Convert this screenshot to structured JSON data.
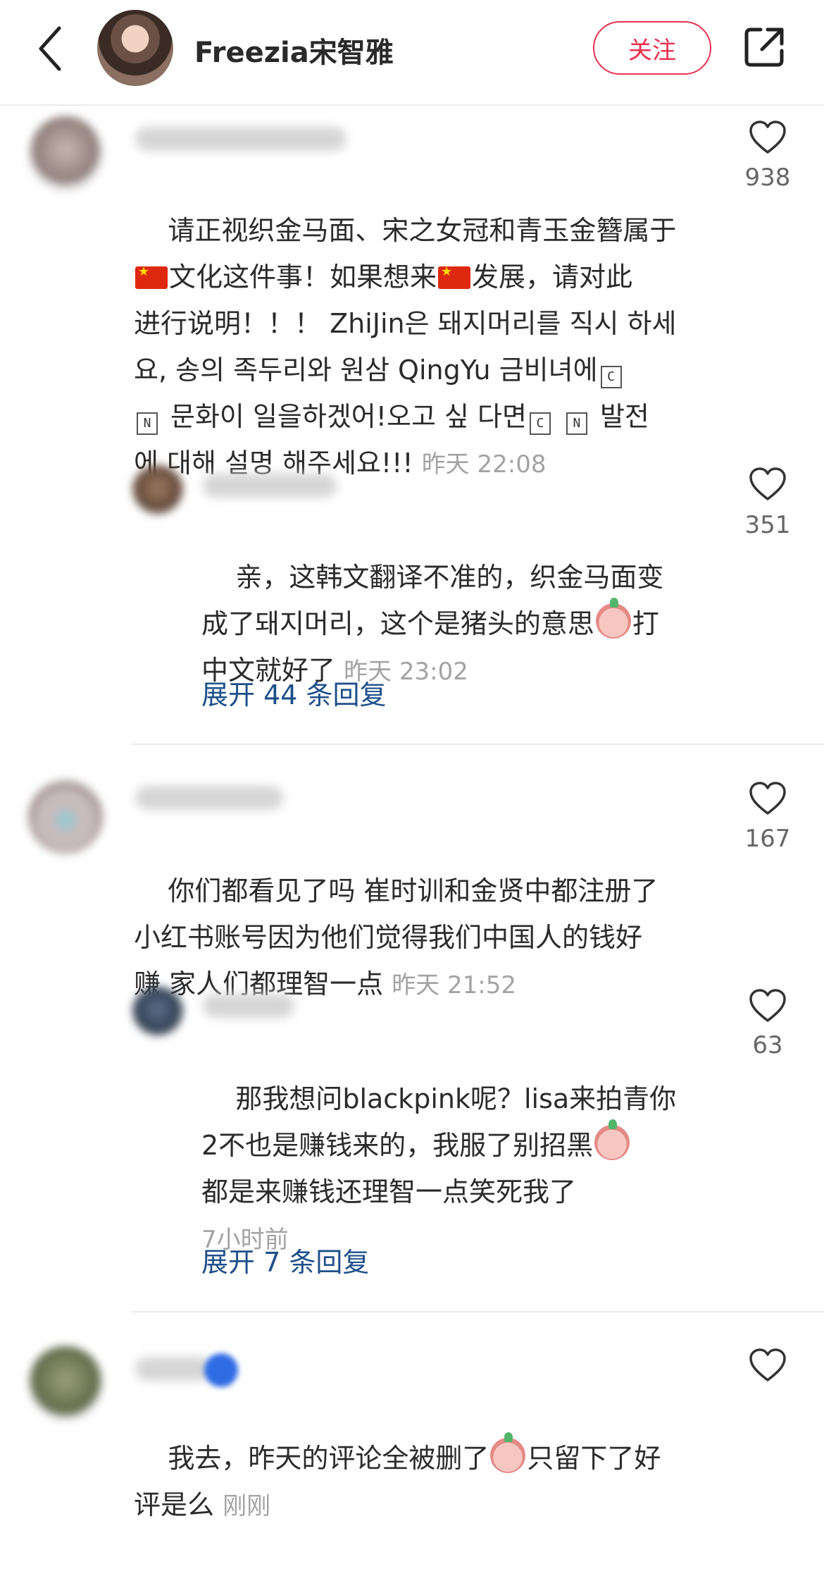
{
  "header": {
    "title": "Freezia宋智雅",
    "follow_label": "关注"
  },
  "comments": [
    {
      "lines": [
        "请正视织金马面、宋之女冠和青玉金簪属于",
        "文化这件事！如果想来",
        "发展，请对此",
        "进行说明！！！ ZhiJin은 돼지머리를 직시 하세",
        "요, 송의 족두리와 원삼 QingYu 금비녀에",
        "문화이 일을하겠어!오고 싶 다면",
        "발전",
        "에 대해 설명 해주세요!!!"
      ],
      "time": "昨天 22:08",
      "likes": "938",
      "reply": {
        "lines": [
          "亲，这韩文翻译不准的，织金马面变",
          "成了돼지머리，这个是猪头的意思",
          "打",
          "中文就好了"
        ],
        "time": "昨天 23:02",
        "likes": "351"
      },
      "expand_label": "展开 44 条回复"
    },
    {
      "lines": [
        "你们都看见了吗 崔时训和金贤中都注册了",
        "小红书账号因为他们觉得我们中国人的钱好",
        "赚 家人们都理智一点"
      ],
      "time": "昨天 21:52",
      "likes": "167",
      "reply": {
        "lines": [
          "那我想问blackpink呢？lisa来拍青你",
          "2不也是赚钱来的，我服了别招黑",
          "都是来赚钱还理智一点笑死我了"
        ],
        "time": "7小时前",
        "likes": "63"
      },
      "expand_label": "展开 7 条回复"
    },
    {
      "lines": [
        "我去，昨天的评论全被删了",
        "只留下了好",
        "评是么"
      ],
      "time": "刚刚"
    }
  ],
  "glyphs": {
    "box_c": "C",
    "box_n": "N"
  },
  "colors": {
    "accent": "#e8324f",
    "link": "#1e4f8a",
    "muted": "#a3a3a3"
  }
}
